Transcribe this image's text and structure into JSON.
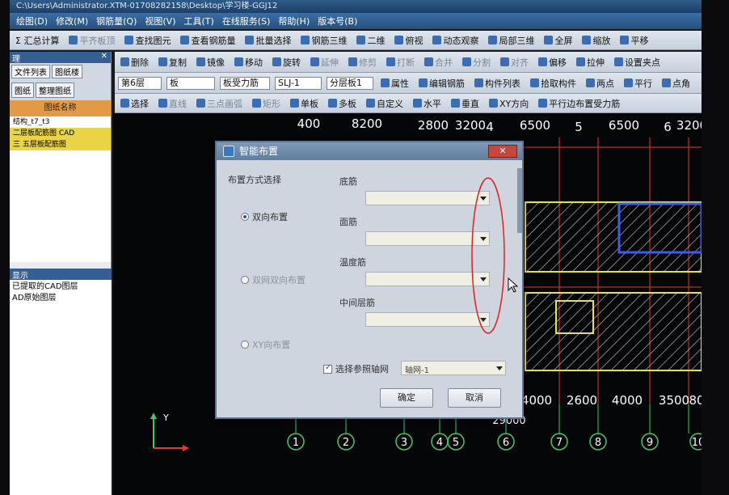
{
  "window": {
    "title": "C:\\Users\\Administrator.XTM-01708282158\\Desktop\\学习楼-GGJ12"
  },
  "menu": [
    "绘图(D)",
    "修改(M)",
    "钢筋量(Q)",
    "视图(V)",
    "工具(T)",
    "在线服务(S)",
    "帮助(H)",
    "版本号(B)"
  ],
  "toolbar1": [
    "Σ 汇总计算",
    "平齐板顶",
    "查找图元",
    "查看钢筋量",
    "批量选择",
    "钢筋三维",
    "二维",
    "俯视",
    "动态观察",
    "局部三维",
    "全屏",
    "缩放",
    "平移"
  ],
  "toolbar2": [
    "删除",
    "复制",
    "镜像",
    "移动",
    "旋转",
    "延伸",
    "修剪",
    "打断",
    "合并",
    "分割",
    "对齐",
    "偏移",
    "拉伸",
    "设置夹点"
  ],
  "toolbar3": {
    "floor": "第6层",
    "type": "板",
    "category": "板受力筋",
    "code": "SLJ-1",
    "layer": "分层板1",
    "items": [
      "属性",
      "编辑钢筋",
      "构件列表",
      "拾取构件",
      "两点",
      "平行",
      "点角"
    ]
  },
  "toolbar4": [
    "选择",
    "直线",
    "三点画弧",
    "矩形",
    "单板",
    "多板",
    "自定义",
    "水平",
    "垂直",
    "XY方向",
    "平行边布置受力筋"
  ],
  "left_panel": {
    "header": "理",
    "tabs": [
      "文件列表",
      "图纸楼"
    ],
    "buttons": [
      "图纸",
      "整理图纸"
    ],
    "column_header": "图纸名称",
    "rows": [
      "结构_t7_t3",
      "二层板配筋图 CAD",
      "三 五层板配筋图"
    ],
    "panel2_header": "显示",
    "panel2_items": [
      "已提取的CAD图层",
      "AD原始图层"
    ]
  },
  "cad": {
    "top_dims": [
      "400",
      "8200",
      "2800",
      "3200",
      "4",
      "6500",
      "5",
      "6500",
      "6",
      "3200"
    ],
    "bottom_dims": [
      "4000",
      "2600",
      "4000",
      "3500",
      "80"
    ],
    "extra_dim": "29000",
    "axis_labels": [
      "1",
      "2",
      "3",
      "4",
      "5",
      "6",
      "7",
      "8",
      "9",
      "10"
    ],
    "ucs_y": "Y",
    "colors": {
      "dim_text": "#ffffff",
      "axis": "#43c96b",
      "wall": "#e8e53a",
      "grid_red": "#e23838",
      "slab_blue": "#3a5cf0",
      "hatch": "#d8d8d8"
    }
  },
  "dialog": {
    "title": "智能布置",
    "section_label": "布置方式选择",
    "radios": [
      {
        "label": "双向布置",
        "selected": true
      },
      {
        "label": "双网双向布置",
        "selected": false
      },
      {
        "label": "XY向布置",
        "selected": false
      }
    ],
    "fields": [
      {
        "label": "底筋",
        "value": ""
      },
      {
        "label": "面筋",
        "value": ""
      },
      {
        "label": "温度筋",
        "value": ""
      },
      {
        "label": "中间层筋",
        "value": ""
      }
    ],
    "checkbox_label": "选择参照轴网",
    "checkbox_checked": true,
    "axis_select": "轴网-1",
    "ok": "确定",
    "cancel": "取消",
    "annotation_color": "#e02020"
  }
}
